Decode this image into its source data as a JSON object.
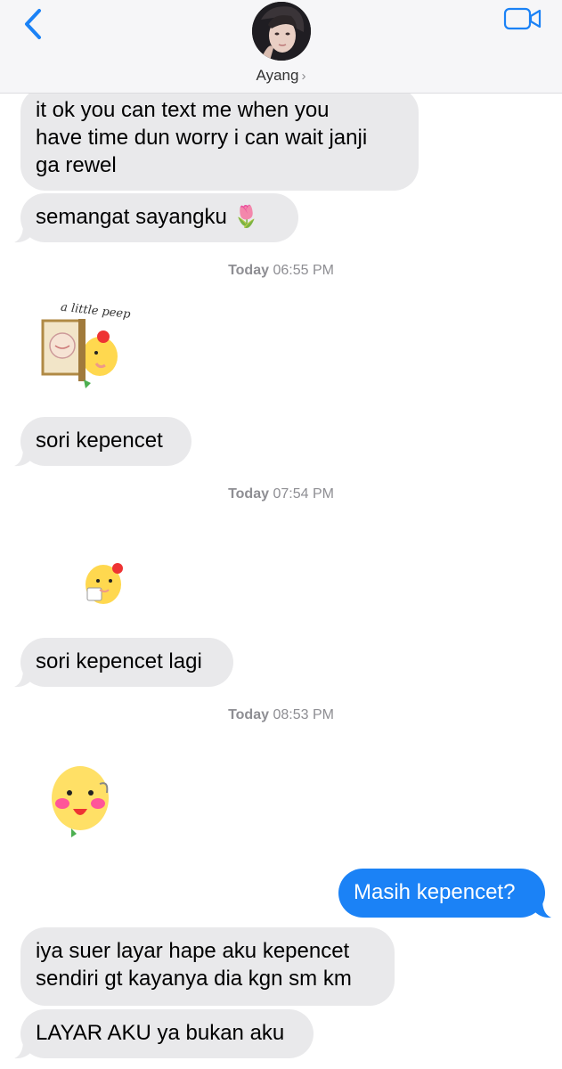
{
  "header": {
    "contact_name": "Ayang",
    "chevron": "›",
    "back_icon": "chevron-left-icon",
    "video_icon": "video-camera-icon",
    "accent_color": "#1b82f6"
  },
  "messages": [
    {
      "type": "in",
      "lines": [
        "it ok you can text me when you",
        "have time dun worry i can wait janji",
        "ga rewel"
      ]
    },
    {
      "type": "in",
      "text": "semangat sayangku 🌷"
    },
    {
      "type": "timestamp",
      "day": "Today",
      "time": "06:55 PM"
    },
    {
      "type": "sticker",
      "caption": "a little peep"
    },
    {
      "type": "in",
      "text": "sori kepencet"
    },
    {
      "type": "timestamp",
      "day": "Today",
      "time": "07:54 PM"
    },
    {
      "type": "sticker"
    },
    {
      "type": "in",
      "text": "sori kepencet lagi"
    },
    {
      "type": "timestamp",
      "day": "Today",
      "time": "08:53 PM"
    },
    {
      "type": "sticker"
    },
    {
      "type": "out",
      "text": "Masih kepencet?"
    },
    {
      "type": "in",
      "lines": [
        "iya suer layar hape aku kepencet",
        "sendiri gt kayanya dia kgn sm km"
      ]
    },
    {
      "type": "in",
      "text": "LAYAR AKU ya bukan aku"
    }
  ]
}
